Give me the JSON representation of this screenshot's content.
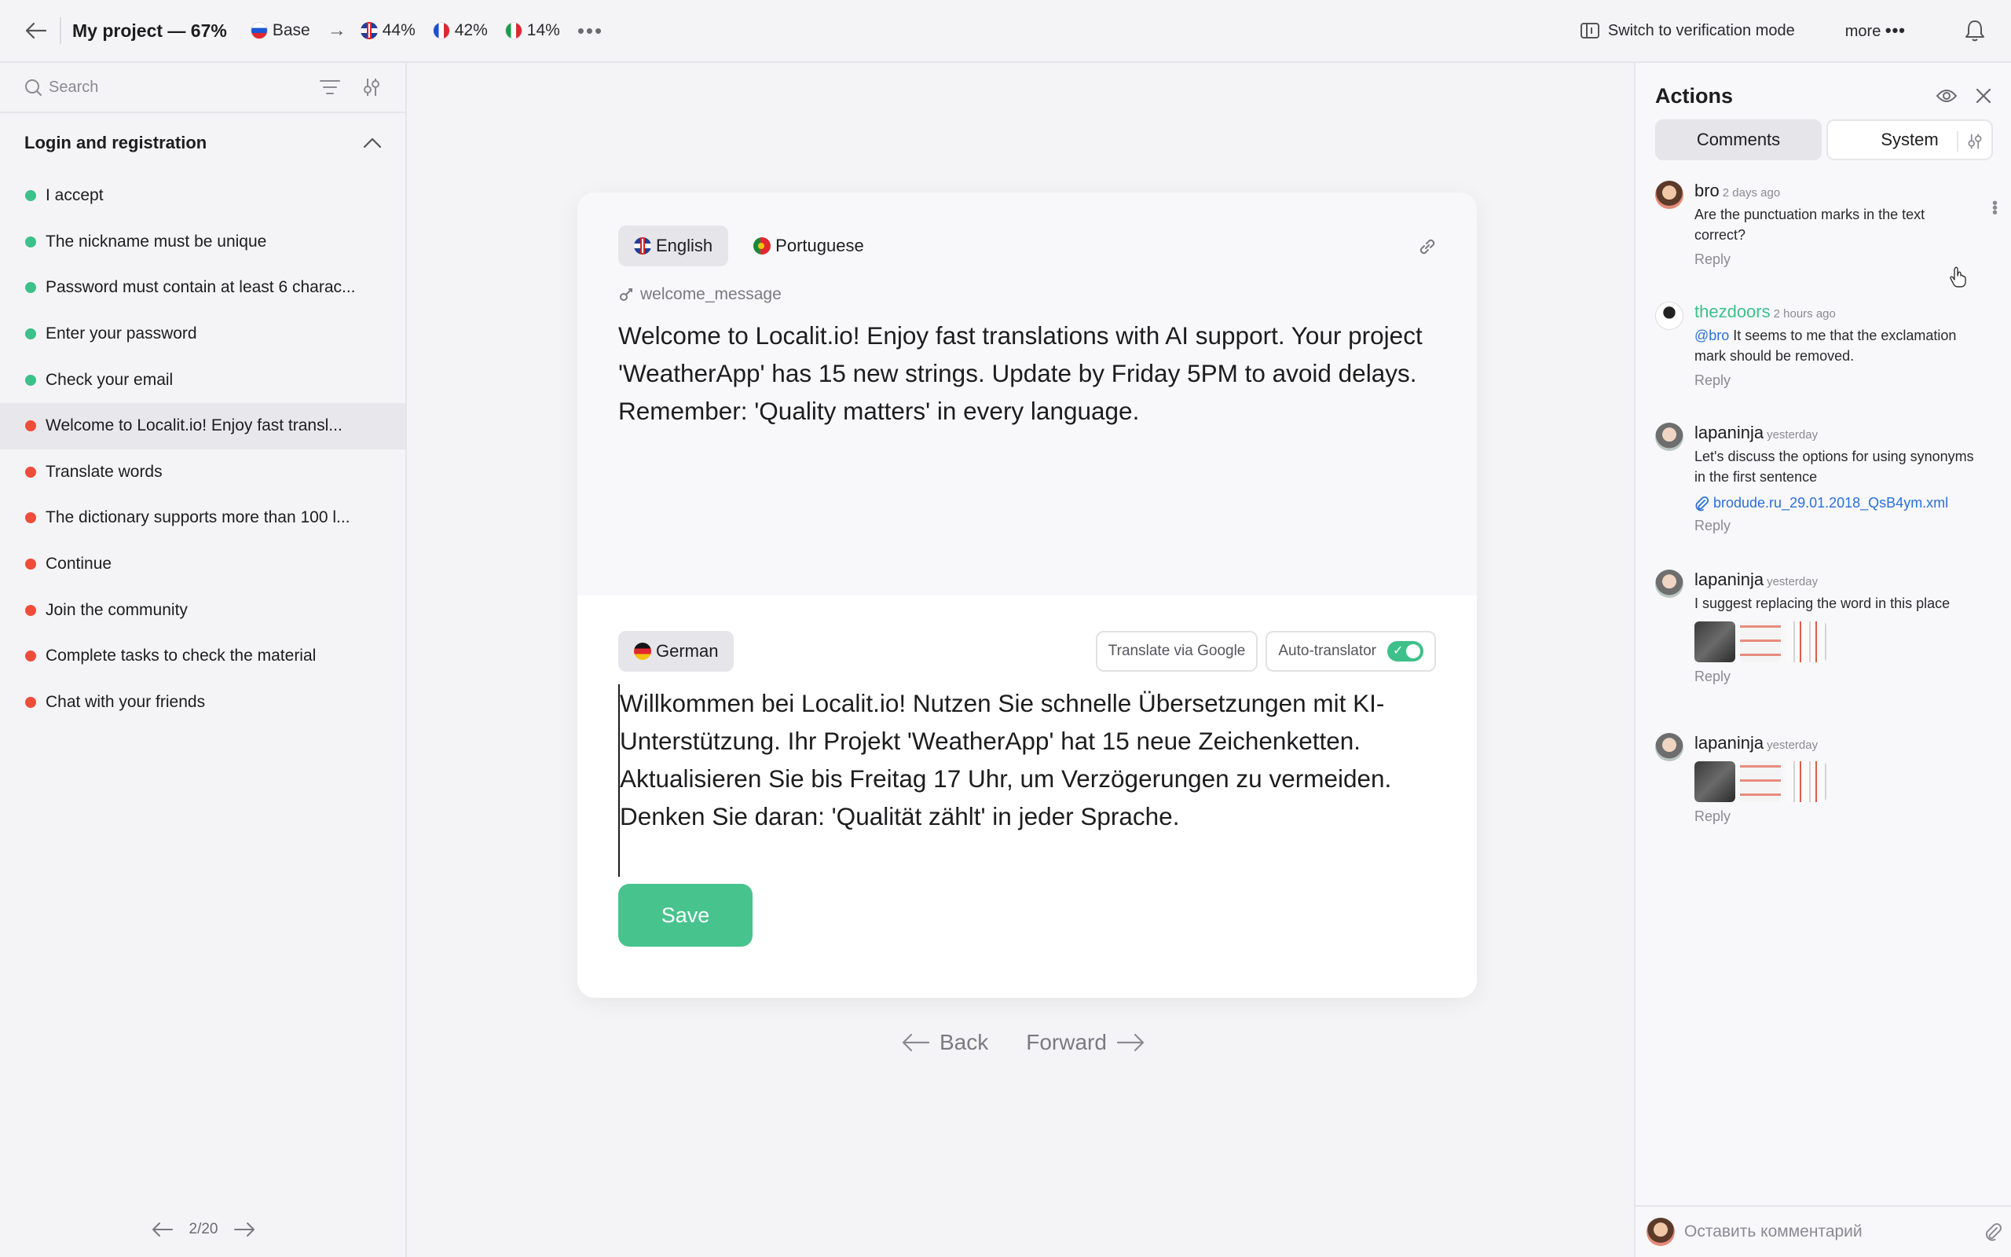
{
  "topbar": {
    "title": "My project — 67%",
    "languages": [
      {
        "label": "Base",
        "flag": "ru"
      },
      {
        "label": "44%",
        "flag": "gb"
      },
      {
        "label": "42%",
        "flag": "fr"
      },
      {
        "label": "14%",
        "flag": "it"
      }
    ],
    "arrow": "→",
    "more_dots": "•••",
    "verification_label": "Switch to verification mode",
    "more_label": "more",
    "more_glyph": "•••"
  },
  "sidebar": {
    "search_placeholder": "Search",
    "group_title": "Login and registration",
    "items": [
      {
        "label": "I accept",
        "status": "done"
      },
      {
        "label": "The nickname must be unique",
        "status": "done"
      },
      {
        "label": "Password must contain at least 6 charac...",
        "status": "done"
      },
      {
        "label": "Enter your password",
        "status": "done"
      },
      {
        "label": "Check your email",
        "status": "done"
      },
      {
        "label": "Welcome to Localit.io! Enjoy fast transl...",
        "status": "todo"
      },
      {
        "label": "Translate words",
        "status": "todo"
      },
      {
        "label": "The dictionary supports more than 100 l...",
        "status": "todo"
      },
      {
        "label": "Continue",
        "status": "todo"
      },
      {
        "label": "Join the community",
        "status": "todo"
      },
      {
        "label": "Complete tasks to check the material",
        "status": "todo"
      },
      {
        "label": "Chat with your friends",
        "status": "todo"
      }
    ],
    "pager": "2/20"
  },
  "editor": {
    "source_tabs": [
      {
        "label": "English",
        "flag": "gb"
      },
      {
        "label": "Portuguese",
        "flag": "pt"
      }
    ],
    "key": "welcome_message",
    "source_text": "Welcome to Localit.io! Enjoy fast translations with AI support. Your project 'WeatherApp' has 15 new strings. Update by Friday 5PM to avoid delays. Remember: 'Quality matters' in every language.",
    "target_language": "German",
    "translate_google_label": "Translate via Google",
    "auto_translator_label": "Auto-translator",
    "auto_translator_check": "✓",
    "target_text": "Willkommen bei Localit.io! Nutzen Sie schnelle Übersetzungen mit KI-Unterstützung. Ihr Projekt 'WeatherApp' hat 15 neue Zeichenketten. Aktualisieren Sie bis Freitag 17 Uhr, um Verzögerungen zu vermeiden. Denken Sie daran: 'Qualität zählt' in jeder Sprache.",
    "save_label": "Save",
    "back_label": "Back",
    "forward_label": "Forward"
  },
  "actions": {
    "title": "Actions",
    "tabs": [
      "Comments",
      "System"
    ],
    "comments": [
      {
        "author": "bro",
        "time": "2 days ago",
        "text": "Are the punctuation marks in the text correct?",
        "reply": "Reply"
      },
      {
        "author": "thezdoors",
        "time": "2 hours ago",
        "mention": "@bro",
        "text": " It seems to me that the exclamation mark should be removed.",
        "reply": "Reply"
      },
      {
        "author": "lapaninja",
        "time": "yesterday",
        "text": "Let's discuss the options for using synonyms in the first sentence",
        "file": "brodude.ru_29.01.2018_QsB4ym.xml",
        "reply": "Reply"
      },
      {
        "author": "lapaninja",
        "time": "yesterday",
        "text": "I suggest replacing the word in this place",
        "reply": "Reply"
      },
      {
        "author": "lapaninja",
        "time": "yesterday",
        "reply": "Reply"
      }
    ],
    "comment_placeholder": "Оставить комментарий"
  },
  "colors": {
    "accent": "#47c48d",
    "status_done": "#3ec08a",
    "status_todo": "#ee4d3a",
    "link": "#2a6fd6"
  }
}
